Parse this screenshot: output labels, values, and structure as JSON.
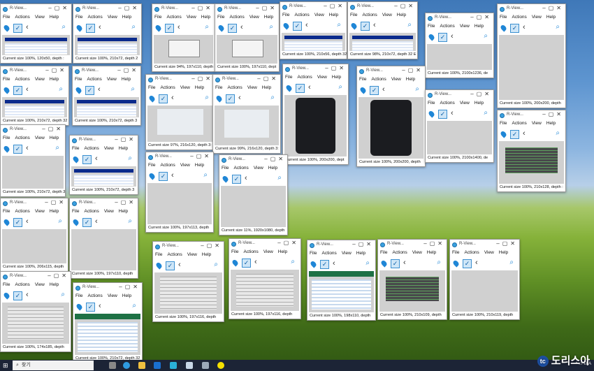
{
  "title_text": "R-View...",
  "menu": [
    "File",
    "Actions",
    "View",
    "Help"
  ],
  "statuses": [
    "Current size 100%, 120x50, depth :",
    "Current size 100%, 210x72, depth 2",
    "Current size 94%, 197x110, depth",
    "Current size 100%, 197x110, dept",
    "Current size 100%, 210x56, depth 32",
    "Current size 98%, 210x72, depth 32 E",
    "Current size 100%, 2100x1236, de",
    "Current size 100%, 200x200, depth",
    "Current size 100%, 210x72, depth 32",
    "Current size 100%, 210x72, depth 3",
    "Current size 97%, 216x120, depth 3:",
    "Current size 99%, 216x120, depth 3:",
    "Current size 100%, 200x200, dept",
    "Current size 100%, 200x200, depth",
    "Current size 100%, 2100x1400, de",
    "Current size 100%, 210x128, depth :",
    "Current size 100%, 210x72, depth 3",
    "Current size 100%, 197x113, depth",
    "Current size 11%, 1920x1080, depth",
    "Current size 100%, 206x115, depth",
    "Current size 100%, 197x110, depth",
    "Current size 100%, 197x116, depth",
    "Current size 100%, 197x116, depth",
    "Current size 100%, 198x110, depth",
    "Current size 100%, 210x109, depth",
    "Current size 100%, 210x119, depth",
    "Current size 100%, 174x185, depth",
    "Current size 100%, 210x72, depth 32"
  ],
  "taskbar": {
    "search_placeholder": "찾기"
  },
  "watermark": "도리스아"
}
